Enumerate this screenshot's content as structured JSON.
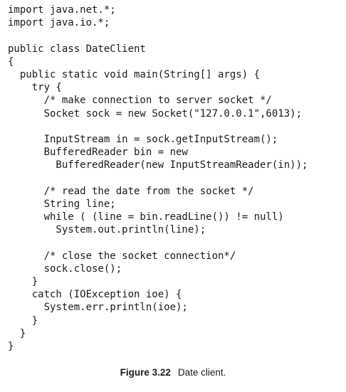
{
  "code_lines": [
    "import java.net.*;",
    "import java.io.*;",
    "",
    "public class DateClient",
    "{",
    "  public static void main(String[] args) {",
    "    try {",
    "      /* make connection to server socket */",
    "      Socket sock = new Socket(\"127.0.0.1\",6013);",
    "",
    "      InputStream in = sock.getInputStream();",
    "      BufferedReader bin = new",
    "        BufferedReader(new InputStreamReader(in));",
    "",
    "      /* read the date from the socket */",
    "      String line;",
    "      while ( (line = bin.readLine()) != null)",
    "        System.out.println(line);",
    "",
    "      /* close the socket connection*/",
    "      sock.close();",
    "    }",
    "    catch (IOException ioe) {",
    "      System.err.println(ioe);",
    "    }",
    "  }",
    "}"
  ],
  "caption": {
    "label": "Figure 3.22",
    "text": "Date client."
  }
}
